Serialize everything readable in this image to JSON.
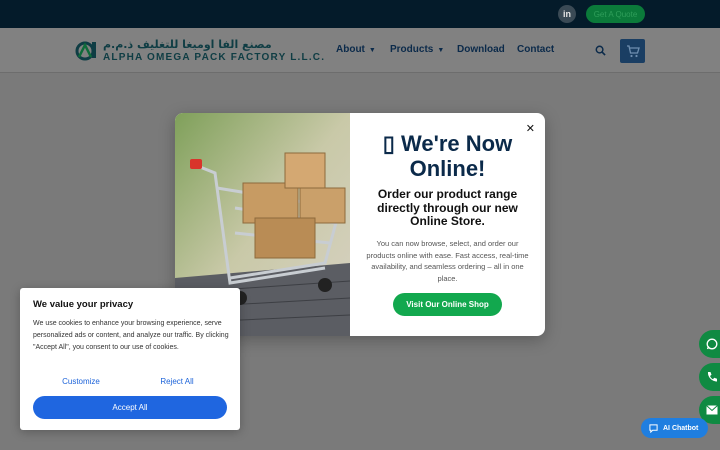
{
  "topbar": {
    "linkedin_label": "in",
    "quote_label": "Get A Quote"
  },
  "brand": {
    "arabic_name": "مصنع الفا اوميغا للتغليف ذ.م.م",
    "english_name": "ALPHA OMEGA PACK FACTORY L.L.C."
  },
  "nav": {
    "items": [
      {
        "label": "About",
        "has_caret": true
      },
      {
        "label": "Products",
        "has_caret": true
      },
      {
        "label": "Download",
        "has_caret": false
      },
      {
        "label": "Contact",
        "has_caret": false
      }
    ],
    "caret_glyph": "▼"
  },
  "modal": {
    "title_icon": "▯",
    "title": "We're Now Online!",
    "subtitle": "Order our product range directly through our new Online Store.",
    "body": "You can now browse, select, and order our products online with ease. Fast access, real-time availability, and seamless ordering – all in one place.",
    "cta_label": "Visit Our Online Shop",
    "close_glyph": "✕"
  },
  "cookie": {
    "title": "We value your privacy",
    "body": "We use cookies to enhance your browsing experience, serve personalized ads or content, and analyze our traffic. By clicking \"Accept All\", you consent to our use of cookies.",
    "customize_label": "Customize",
    "reject_label": "Reject All",
    "accept_label": "Accept All"
  },
  "chatbot": {
    "label": "AI Chatbot"
  },
  "colors": {
    "topbar": "#041b2a",
    "navy": "#0b2a4a",
    "green": "#12a84e",
    "blue": "#1f66e0"
  }
}
